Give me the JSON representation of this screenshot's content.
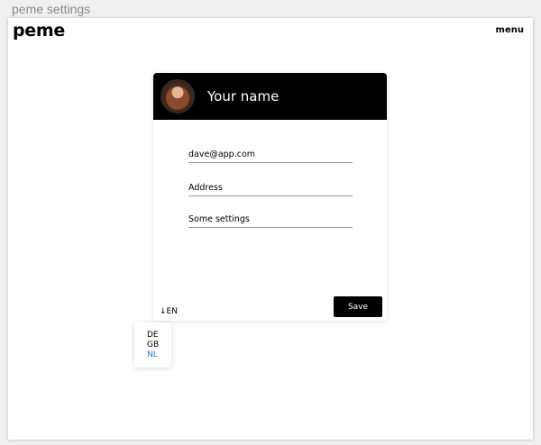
{
  "window": {
    "title": "peme settings"
  },
  "header": {
    "logo": "peme",
    "menu_label": "menu"
  },
  "profile": {
    "name": "Your name",
    "fields": [
      {
        "value": "dave@app.com"
      },
      {
        "value": "Address"
      },
      {
        "value": "Some settings"
      }
    ],
    "save_label": "Save"
  },
  "language": {
    "current": "↓EN",
    "options": [
      {
        "label": "DE"
      },
      {
        "label": "GB"
      },
      {
        "label": "NL",
        "active": true
      }
    ],
    "active_color": "#1a73e8"
  },
  "colors": {
    "header_bg": "#000000",
    "button_bg": "#000000"
  }
}
